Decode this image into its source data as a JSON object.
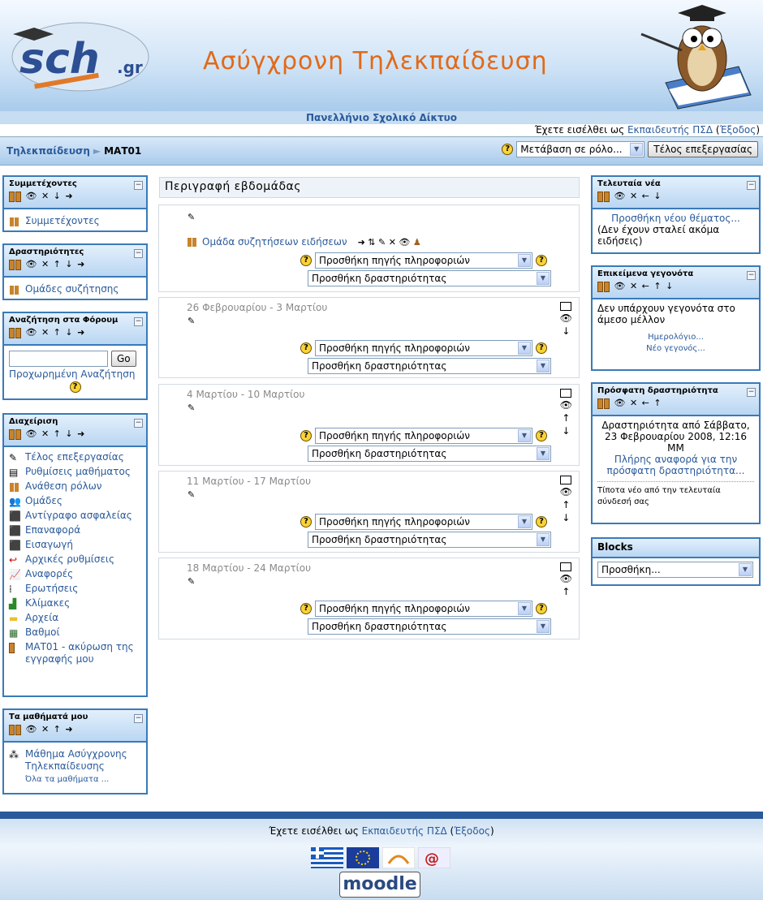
{
  "header": {
    "logo_text": "sch.gr",
    "site_name": "Ασύγχρονη Τηλεκπαίδευση",
    "network": "Πανελλήνιο Σχολικό Δίκτυο"
  },
  "login": {
    "prefix": "Έχετε εισέλθει ως ",
    "user": "Εκπαιδευτής ΠΣΔ",
    "open": " (",
    "logout": "Έξοδος",
    "close": ")"
  },
  "nav": {
    "crumb_home": "Τηλεκπαίδευση",
    "crumb_sep": "►",
    "crumb_course": "ΜΑΤ01",
    "role_select": "Μετάβαση σε ρόλο...",
    "end_edit_button": "Τέλος επεξεργασίας"
  },
  "left": {
    "participants": {
      "title": "Συμμετέχοντες",
      "item": "Συμμετέχοντες"
    },
    "activities": {
      "title": "Δραστηριότητες",
      "item": "Ομάδες συζήτησης"
    },
    "forum_search": {
      "title": "Αναζήτηση στα Φόρουμ",
      "go": "Go",
      "advanced": "Προχωρημένη Αναζήτηση",
      "query": ""
    },
    "admin": {
      "title": "Διαχείριση",
      "items": [
        "Τέλος επεξεργασίας",
        "Ρυθμίσεις μαθήματος",
        "Ανάθεση ρόλων",
        "Ομάδες",
        "Αντίγραφο ασφαλείας",
        "Επαναφορά",
        "Εισαγωγή",
        "Αρχικές ρυθμίσεις",
        "Αναφορές",
        "Ερωτήσεις",
        "Κλίμακες",
        "Αρχεία",
        "Βαθμοί",
        "ΜΑΤ01 - ακύρωση της εγγραφής μου"
      ]
    },
    "mycourses": {
      "title": "Τα μαθήματά μου",
      "course": "Μάθημα Ασύγχρονης Τηλεκπαίδευσης",
      "all": "Όλα τα μαθήματα ..."
    }
  },
  "center": {
    "title": "Περιγραφή εβδομάδας",
    "news_forum": "Ομάδα συζητήσεων ειδήσεων",
    "add_resource": "Προσθήκη πηγής πληροφοριών",
    "add_activity": "Προσθήκη δραστηριότητας",
    "weeks": [
      "26 Φεβρουαρίου - 3 Μαρτίου",
      "4 Μαρτίου - 10 Μαρτίου",
      "11 Μαρτίου - 17 Μαρτίου",
      "18 Μαρτίου - 24 Μαρτίου"
    ]
  },
  "right": {
    "news": {
      "title": "Τελευταία νέα",
      "add": "Προσθήκη νέου θέματος...",
      "empty": "(Δεν έχουν σταλεί ακόμα ειδήσεις)"
    },
    "events": {
      "title": "Επικείμενα γεγονότα",
      "empty": "Δεν υπάρχουν γεγονότα στο άμεσο μέλλον",
      "calendar": "Ημερολόγιο...",
      "new_event": "Νέο γεγονός..."
    },
    "recent": {
      "title": "Πρόσφατη δραστηριότητα",
      "since": "Δραστηριότητα από Σάββατο, 23 Φεβρουαρίου 2008, 12:16 ΜΜ",
      "full_report": "Πλήρης αναφορά για την πρόσφατη δραστηριότητα...",
      "nothing": "Τίποτα νέο από την τελευταία σύνδεσή σας"
    },
    "blocks": {
      "title": "Blocks",
      "add": "Προσθήκη..."
    }
  },
  "footer": {
    "moodle": "moodle"
  }
}
